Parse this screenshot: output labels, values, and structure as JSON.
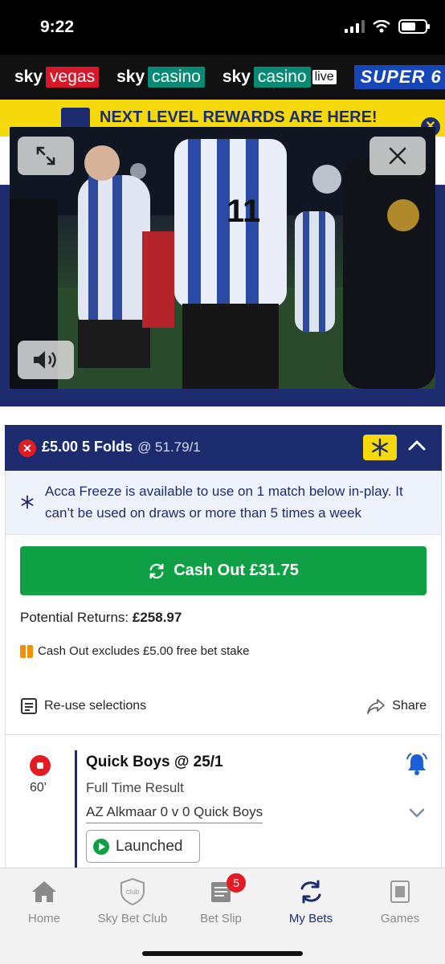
{
  "status": {
    "time": "9:22"
  },
  "brands": {
    "vegas_sky": "sky",
    "vegas": "vegas",
    "casino_sky": "sky",
    "casino": "casino",
    "live_sky": "sky",
    "live_casino": "casino",
    "live_tag": "live",
    "super6": "SUPER 6"
  },
  "promo": {
    "text": "NEXT LEVEL REWARDS ARE HERE!"
  },
  "video": {
    "shirt_number": "11"
  },
  "bet": {
    "stake_title": "£5.00 5 Folds",
    "odds": "@ 51.79/1",
    "freeze_info": "Acca Freeze is available to use on 1 match below in-play. It can’t be used on draws or more than 5 times a week",
    "cashout_label": "Cash Out £31.75",
    "returns_label": "Potential Returns:",
    "returns_value": "£258.97",
    "excludes_text": "Cash Out excludes £5.00 free bet stake",
    "reuse_label": "Re-use selections",
    "share_label": "Share"
  },
  "selection": {
    "minute": "60'",
    "title": "Quick Boys @ 25/1",
    "market": "Full Time Result",
    "match": "AZ Alkmaar 0 v 0 Quick Boys",
    "status": "Launched"
  },
  "tabs": [
    {
      "label": "Home",
      "icon": "home-icon"
    },
    {
      "label": "Sky Bet Club",
      "icon": "club-icon"
    },
    {
      "label": "Bet Slip",
      "icon": "betslip-icon",
      "badge": "5"
    },
    {
      "label": "My Bets",
      "icon": "mybets-icon"
    },
    {
      "label": "Games",
      "icon": "games-icon"
    }
  ],
  "colors": {
    "navy": "#1d2c6f",
    "green": "#0fa046",
    "yellow": "#f5d90a",
    "red": "#e31b23"
  }
}
